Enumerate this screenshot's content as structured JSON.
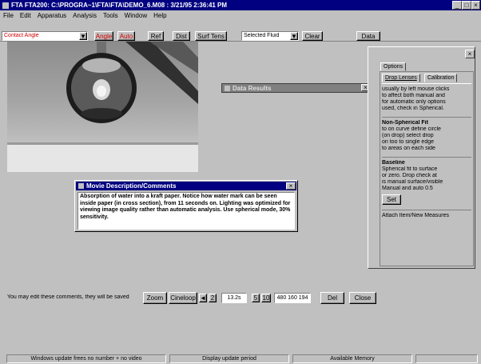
{
  "window": {
    "title": "FTA FTA200: C:\\PROGRA~1\\FTA\\FTA\\DEMO_6.M08 : 3/21/95 2:36:41 PM",
    "min": "_",
    "max": "□",
    "close": "×"
  },
  "menu": [
    "File",
    "Edit",
    "Apparatus",
    "Analysis",
    "Tools",
    "Window",
    "Help"
  ],
  "toolbar": {
    "mode_select": "Contact Angle",
    "angle_btn": "Angle",
    "auto_btn": "Auto",
    "ref_btn": "Ref",
    "dist_btn": "Dist",
    "surf_btn": "Surf Tens",
    "fluid_select": "Selected Fluid",
    "clear_btn": "Clear",
    "data_btn": "Data"
  },
  "data_results": {
    "title": "Data Results",
    "close": "×"
  },
  "right_panel": {
    "close": "×",
    "top_tab": "Options",
    "tabs": [
      "Drop Lenses",
      "Calibration"
    ],
    "text1": [
      "usually by left mouse clicks",
      "to affect both manual and",
      "for automatic only options",
      "used, check in Spherical."
    ],
    "heading2": "Non-Spherical Fit",
    "text2": [
      "to on curve define circle",
      "(on drop) select drop",
      "on too to single edge",
      "to areas on each side"
    ],
    "heading3": "Baseline",
    "text3": [
      "Spherical fit to surface",
      "or zero. Drop check at",
      "is manual surface/visible",
      "Manual and auto 0.5"
    ],
    "ok_btn": "Set",
    "text4": "Attach Item/New Measures"
  },
  "movie": {
    "title": "Movie Description/Comments",
    "close": "×",
    "body": "Absorption of water into a kraft paper. Notice how water mark can be seen inside paper (in cross section), from 11 seconds on. Lighting was optimized for viewing image quality rather than automatic analysis. Use spherical mode, 30% sensitivity."
  },
  "frame_bar": {
    "comment": "You may edit these comments, they will be saved",
    "zoom_btn": "Zoom",
    "cineloop_btn": "Cineloop",
    "prev_btn": "◄",
    "step_btn": "2",
    "time_value": "13.2s",
    "play_btn": "5",
    "next_btn": "10",
    "frame_value": "480 160 194",
    "del_btn": "Del",
    "close_btn": "Close"
  },
  "status": {
    "left": "Windows update frees no number + no video",
    "middle": "Display update period",
    "right": "Available Memory"
  }
}
